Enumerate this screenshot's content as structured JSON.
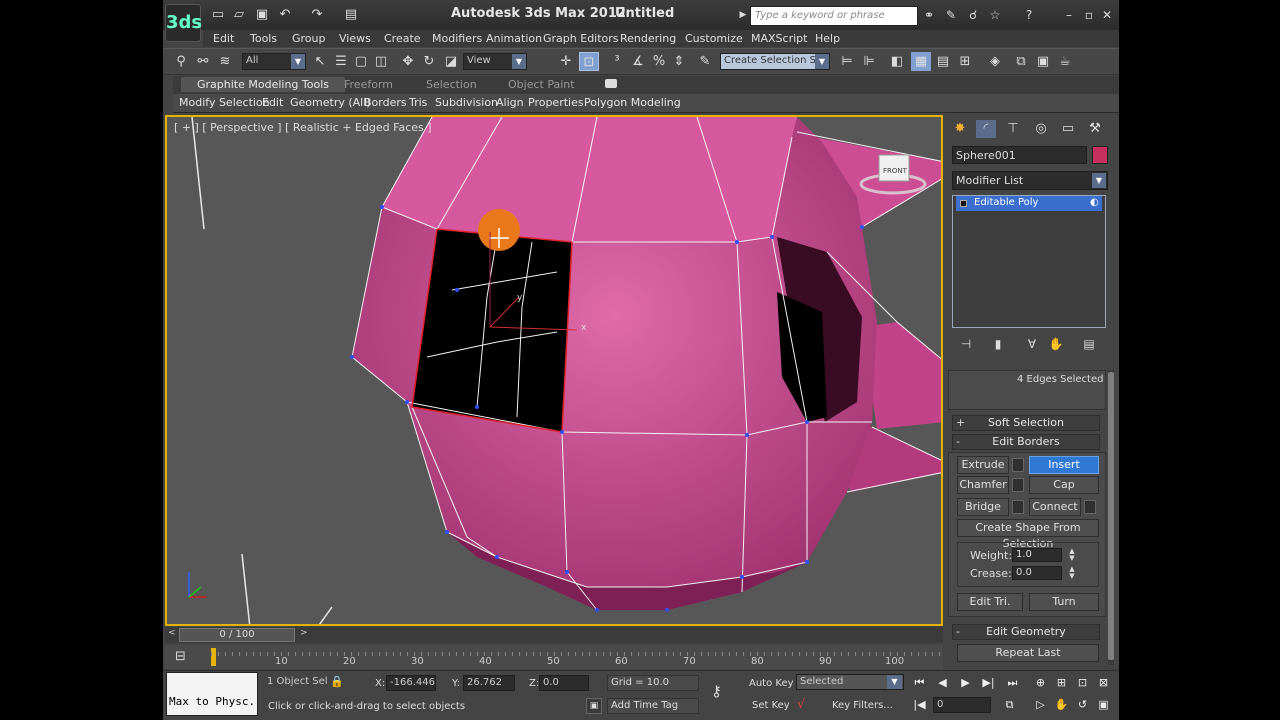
{
  "titlebar": {
    "logo": "3ds",
    "app_title": "Autodesk 3ds Max  2012",
    "doc_title": "Untitled",
    "search_placeholder": "Type a keyword or phrase"
  },
  "menu": [
    "Edit",
    "Tools",
    "Group",
    "Views",
    "Create",
    "Modifiers",
    "Animation",
    "Graph Editors",
    "Rendering",
    "Customize",
    "MAXScript",
    "Help"
  ],
  "toolbar": {
    "selection_filter": "All",
    "ref_coord": "View",
    "named_selection": "Create Selection Se"
  },
  "ribbon": {
    "tabs": [
      "Graphite Modeling Tools",
      "Freeform",
      "Selection",
      "Object Paint"
    ],
    "panels": [
      "Modify Selection",
      "Edit",
      "Geometry (All)",
      "Borders",
      "Tris",
      "Subdivision",
      "Align",
      "Properties",
      "Polygon Modeling"
    ]
  },
  "viewport": {
    "label": "[ + ] [ Perspective ] [ Realistic + Edged Faces ]",
    "viewcube_label": "FRONT",
    "gizmo_x": "x",
    "gizmo_y": "y",
    "colors": {
      "mesh": "#cf4f97",
      "border": "#e6b400",
      "background": "#575757"
    }
  },
  "command_panel": {
    "object_name": "Sphere001",
    "object_color": "#c8305f",
    "modifier_list": "Modifier List",
    "stack_item": "Editable Poly",
    "selection_info": "4 Edges Selected",
    "soft_selection": "Soft Selection",
    "edit_borders": "Edit Borders",
    "buttons": {
      "extrude": "Extrude",
      "insert_vertex": "Insert Vertex",
      "chamfer": "Chamfer",
      "cap": "Cap",
      "bridge": "Bridge",
      "connect": "Connect",
      "create_shape": "Create Shape From Selection",
      "edit_tri": "Edit Tri.",
      "turn": "Turn",
      "repeat_last": "Repeat Last"
    },
    "weight_label": "Weight:",
    "weight_value": "1.0",
    "crease_label": "Crease:",
    "crease_value": "0.0",
    "edit_geometry": "Edit Geometry"
  },
  "timeline": {
    "slider": "0 / 100",
    "ticks": [
      "10",
      "20",
      "30",
      "40",
      "50",
      "60",
      "70",
      "80",
      "90",
      "100"
    ]
  },
  "status": {
    "maxscript": "Max to Physc.",
    "objects_selected": "1 Object Sel",
    "prompt": "Click or click-and-drag to select objects",
    "x_label": "X:",
    "x_value": "-166.446",
    "y_label": "Y:",
    "y_value": "26.762",
    "z_label": "Z:",
    "z_value": "0.0",
    "grid": "Grid = 10.0",
    "add_time_tag": "Add Time Tag",
    "auto_key": "Auto Key",
    "set_key": "Set Key",
    "selected": "Selected",
    "key_filters": "Key Filters...",
    "frame": "0"
  }
}
